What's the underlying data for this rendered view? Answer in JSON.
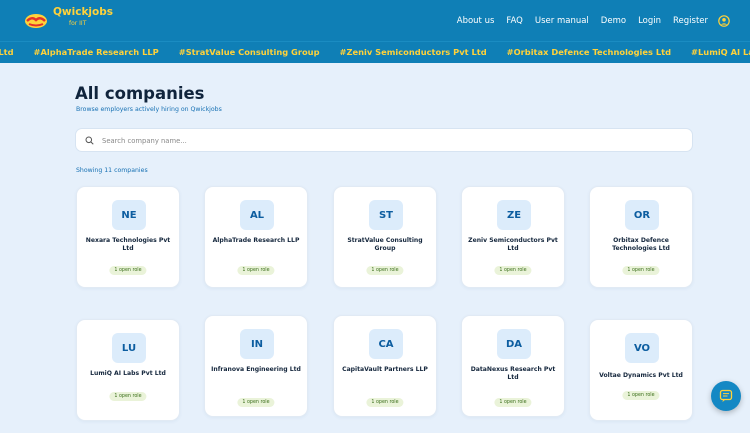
{
  "brand": {
    "name": "Qwickjobs",
    "sub": "for IIT"
  },
  "nav": {
    "items": [
      "About us",
      "FAQ",
      "User manual",
      "Demo",
      "Login",
      "Register"
    ]
  },
  "ticker": [
    "Pvt Ltd",
    "#AlphaTrade Research LLP",
    "#StratValue Consulting Group",
    "#Zeniv Semiconductors Pvt Ltd",
    "#Orbitax Defence Technologies Ltd",
    "#LumiQ AI Labs Pvt L"
  ],
  "page": {
    "title": "All companies",
    "subtitle": "Browse employers actively hiring on Qwickjobs",
    "search_placeholder": "Search company name...",
    "count_text": "Showing 11 companies"
  },
  "companies": [
    {
      "initials": "NE",
      "name": "Nexara Technologies Pvt Ltd",
      "roles": "1 open role"
    },
    {
      "initials": "AL",
      "name": "AlphaTrade Research LLP",
      "roles": "1 open role"
    },
    {
      "initials": "ST",
      "name": "StratValue Consulting Group",
      "roles": "1 open role"
    },
    {
      "initials": "ZE",
      "name": "Zeniv Semiconductors Pvt Ltd",
      "roles": "1 open role"
    },
    {
      "initials": "OR",
      "name": "Orbitax Defence Technologies Ltd",
      "roles": "1 open role"
    },
    {
      "initials": "LU",
      "name": "LumiQ AI Labs Pvt Ltd",
      "roles": "1 open role"
    },
    {
      "initials": "IN",
      "name": "Infranova Engineering Ltd",
      "roles": "1 open role"
    },
    {
      "initials": "CA",
      "name": "CapitaVault Partners LLP",
      "roles": "1 open role"
    },
    {
      "initials": "DA",
      "name": "DataNexus Research Pvt Ltd",
      "roles": "1 open role"
    },
    {
      "initials": "VO",
      "name": "Voltae Dynamics Pvt Ltd",
      "roles": "1 open role"
    }
  ],
  "icons": {
    "logo": "handshake-logo-icon",
    "user": "user-circle-icon",
    "search": "search-icon",
    "chat": "chat-icon"
  },
  "colors": {
    "topbar": "#0f7fb6",
    "accent_yellow": "#ffd23a",
    "background": "#e6f0fb"
  }
}
